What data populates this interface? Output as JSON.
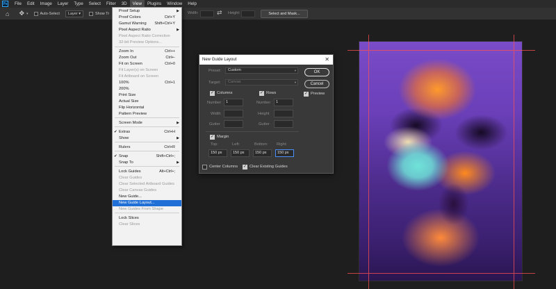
{
  "menubar": {
    "logo": "Ps",
    "items": [
      "File",
      "Edit",
      "Image",
      "Layer",
      "Type",
      "Select",
      "Filter",
      "3D",
      "View",
      "Plugins",
      "Window",
      "Help"
    ],
    "active_index": 8
  },
  "options_bar": {
    "home_icon": "home-icon",
    "move_icon": "move-icon",
    "auto_select_label": "Auto-Select",
    "layer_select_value": "Layer",
    "show_transform_label": "Show Tr",
    "width_label": "Width:",
    "height_label": "Height:",
    "select_and_mask_label": "Select and Mask..."
  },
  "view_menu": {
    "items": [
      {
        "label": "Proof Setup",
        "shortcut": "",
        "submenu": true,
        "disabled": false
      },
      {
        "label": "Proof Colors",
        "shortcut": "Ctrl+Y",
        "submenu": false,
        "disabled": false
      },
      {
        "label": "Gamut Warning",
        "shortcut": "Shift+Ctrl+Y",
        "submenu": false,
        "disabled": false
      },
      {
        "label": "Pixel Aspect Ratio",
        "shortcut": "",
        "submenu": true,
        "disabled": false
      },
      {
        "label": "Pixel Aspect Ratio Correction",
        "shortcut": "",
        "submenu": false,
        "disabled": true
      },
      {
        "label": "32-bit Preview Options...",
        "shortcut": "",
        "submenu": false,
        "disabled": true
      },
      {
        "label": "Zoom In",
        "shortcut": "Ctrl++",
        "submenu": false,
        "disabled": false
      },
      {
        "label": "Zoom Out",
        "shortcut": "Ctrl+-",
        "submenu": false,
        "disabled": false
      },
      {
        "label": "Fit on Screen",
        "shortcut": "Ctrl+0",
        "submenu": false,
        "disabled": false
      },
      {
        "label": "Fit Layer(s) on Screen",
        "shortcut": "",
        "submenu": false,
        "disabled": true
      },
      {
        "label": "Fit Artboard on Screen",
        "shortcut": "",
        "submenu": false,
        "disabled": true
      },
      {
        "label": "100%",
        "shortcut": "Ctrl+1",
        "submenu": false,
        "disabled": false
      },
      {
        "label": "200%",
        "shortcut": "",
        "submenu": false,
        "disabled": false
      },
      {
        "label": "Print Size",
        "shortcut": "",
        "submenu": false,
        "disabled": false
      },
      {
        "label": "Actual Size",
        "shortcut": "",
        "submenu": false,
        "disabled": false
      },
      {
        "label": "Flip Horizontal",
        "shortcut": "",
        "submenu": false,
        "disabled": false
      },
      {
        "label": "Pattern Preview",
        "shortcut": "",
        "submenu": false,
        "disabled": false
      },
      {
        "label": "Screen Mode",
        "shortcut": "",
        "submenu": true,
        "disabled": false
      },
      {
        "label": "Extras",
        "shortcut": "Ctrl+H",
        "submenu": false,
        "disabled": false,
        "checked": true
      },
      {
        "label": "Show",
        "shortcut": "",
        "submenu": true,
        "disabled": false
      },
      {
        "label": "Rulers",
        "shortcut": "Ctrl+R",
        "submenu": false,
        "disabled": false
      },
      {
        "label": "Snap",
        "shortcut": "Shift+Ctrl+;",
        "submenu": false,
        "disabled": false,
        "checked": true
      },
      {
        "label": "Snap To",
        "shortcut": "",
        "submenu": true,
        "disabled": false
      },
      {
        "label": "Lock Guides",
        "shortcut": "Alt+Ctrl+;",
        "submenu": false,
        "disabled": false
      },
      {
        "label": "Clear Guides",
        "shortcut": "",
        "submenu": false,
        "disabled": true
      },
      {
        "label": "Clear Selected Artboard Guides",
        "shortcut": "",
        "submenu": false,
        "disabled": true
      },
      {
        "label": "Clear Canvas Guides",
        "shortcut": "",
        "submenu": false,
        "disabled": true
      },
      {
        "label": "New Guide...",
        "shortcut": "",
        "submenu": false,
        "disabled": false
      },
      {
        "label": "New Guide Layout...",
        "shortcut": "",
        "submenu": false,
        "disabled": false,
        "highlighted": true
      },
      {
        "label": "New Guides From Shape",
        "shortcut": "",
        "submenu": false,
        "disabled": true
      },
      {
        "label": "Lock Slices",
        "shortcut": "",
        "submenu": false,
        "disabled": false
      },
      {
        "label": "Clear Slices",
        "shortcut": "",
        "submenu": false,
        "disabled": true
      }
    ]
  },
  "dialog": {
    "title": "New Guide Layout",
    "preset_label": "Preset:",
    "preset_value": "Custom",
    "target_label": "Target:",
    "target_value": "Canvas",
    "columns_label": "Columns",
    "columns_checked": true,
    "rows_label": "Rows",
    "rows_checked": true,
    "number_label": "Number",
    "width_label": "Width",
    "height_label": "Height",
    "gutter_label": "Gutter",
    "columns_number": "1",
    "rows_number": "1",
    "margin_label": "Margin",
    "margin_checked": true,
    "top_label": "Top:",
    "left_label": "Left:",
    "bottom_label": "Bottom:",
    "right_label": "Right:",
    "top_value": "150 px",
    "left_value": "150 px",
    "bottom_value": "150 px",
    "right_value": "150 px",
    "center_columns_label": "Center Columns",
    "center_columns_checked": false,
    "clear_guides_label": "Clear Existing Guides",
    "clear_guides_checked": true,
    "ok_label": "OK",
    "cancel_label": "Cancel",
    "preview_label": "Preview",
    "preview_checked": true
  },
  "colors": {
    "menu_highlight": "#1f6fd6",
    "guide": "#ff5050",
    "ps_blue": "#31a8ff"
  }
}
